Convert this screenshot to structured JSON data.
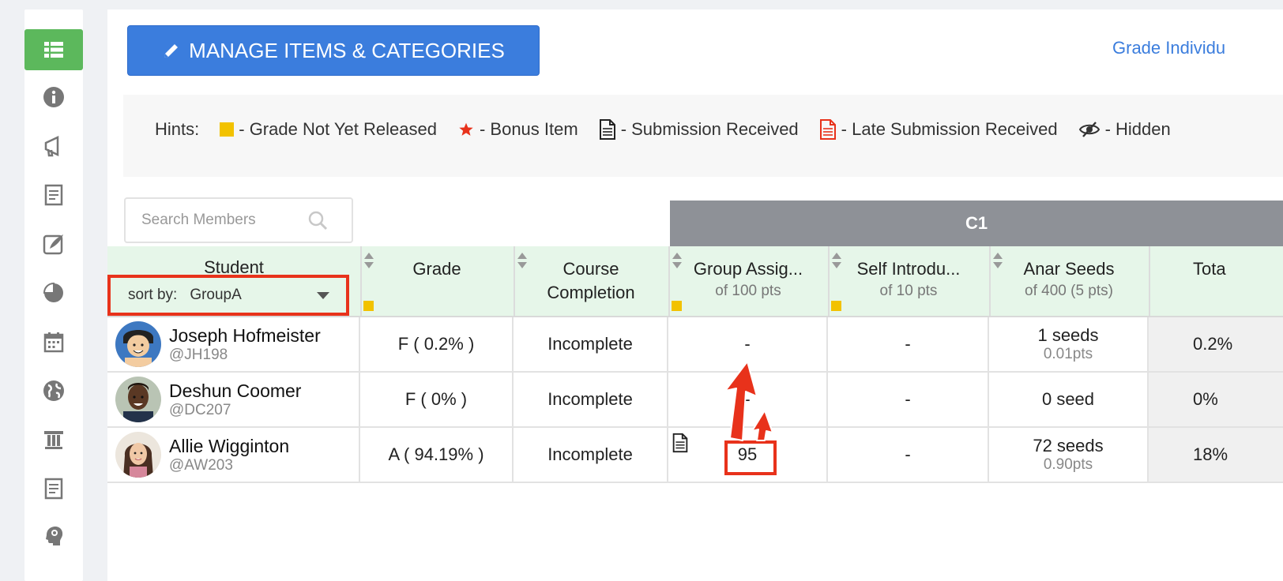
{
  "sidebar": {
    "items": [
      {
        "icon": "list-icon",
        "active": true
      },
      {
        "icon": "info-icon"
      },
      {
        "icon": "megaphone-icon"
      },
      {
        "icon": "document-icon"
      },
      {
        "icon": "edit-note-icon"
      },
      {
        "icon": "pie-chart-icon"
      },
      {
        "icon": "calendar-icon"
      },
      {
        "icon": "globe-icon"
      },
      {
        "icon": "pillar-icon"
      },
      {
        "icon": "document-icon"
      },
      {
        "icon": "brain-head-icon"
      }
    ]
  },
  "toolbar": {
    "manage_label": "MANAGE ITEMS & CATEGORIES",
    "grade_link": "Grade Individu"
  },
  "hints": {
    "label": "Hints:",
    "items": [
      {
        "icon": "yellow-square-icon",
        "text": "- Grade Not Yet Released"
      },
      {
        "icon": "red-star-icon",
        "text": "- Bonus Item"
      },
      {
        "icon": "document-icon",
        "text": "- Submission Received"
      },
      {
        "icon": "red-document-icon",
        "text": "- Late Submission Received"
      },
      {
        "icon": "eye-slash-icon",
        "text": "- Hidden"
      }
    ]
  },
  "search": {
    "placeholder": "Search Members"
  },
  "category_header": "C1",
  "sort": {
    "label": "sort by:",
    "value": "GroupA"
  },
  "columns": {
    "student": "Student",
    "grade": "Grade",
    "course_l1": "Course",
    "course_l2": "Completion",
    "group": {
      "title": "Group Assig...",
      "sub": "of 100 pts"
    },
    "self": {
      "title": "Self Introdu...",
      "sub": "of 10 pts"
    },
    "anar": {
      "title": "Anar Seeds",
      "sub": "of 400 (5 pts)"
    },
    "total": "Tota"
  },
  "rows": [
    {
      "name": "Joseph Hofmeister",
      "handle": "@JH198",
      "grade": "F ( 0.2% )",
      "completion": "Incomplete",
      "group": "-",
      "self": "-",
      "anar": "1 seeds",
      "anar_pts": "0.01pts",
      "total": "0.2%"
    },
    {
      "name": "Deshun Coomer",
      "handle": "@DC207",
      "grade": "F ( 0% )",
      "completion": "Incomplete",
      "group": "-",
      "self": "-",
      "anar": "0 seed",
      "anar_pts": "",
      "total": "0%"
    },
    {
      "name": "Allie Wigginton",
      "handle": "@AW203",
      "grade": "A ( 94.19% )",
      "completion": "Incomplete",
      "group": "95",
      "self": "-",
      "anar": "72 seeds",
      "anar_pts": "0.90pts",
      "total": "18%"
    }
  ],
  "colors": {
    "accent": "#3b7ddd",
    "active_sidebar": "#5cb85c",
    "highlight": "#e8321b",
    "header_bg": "#e6f6e9",
    "category_bg": "#8e9197"
  }
}
